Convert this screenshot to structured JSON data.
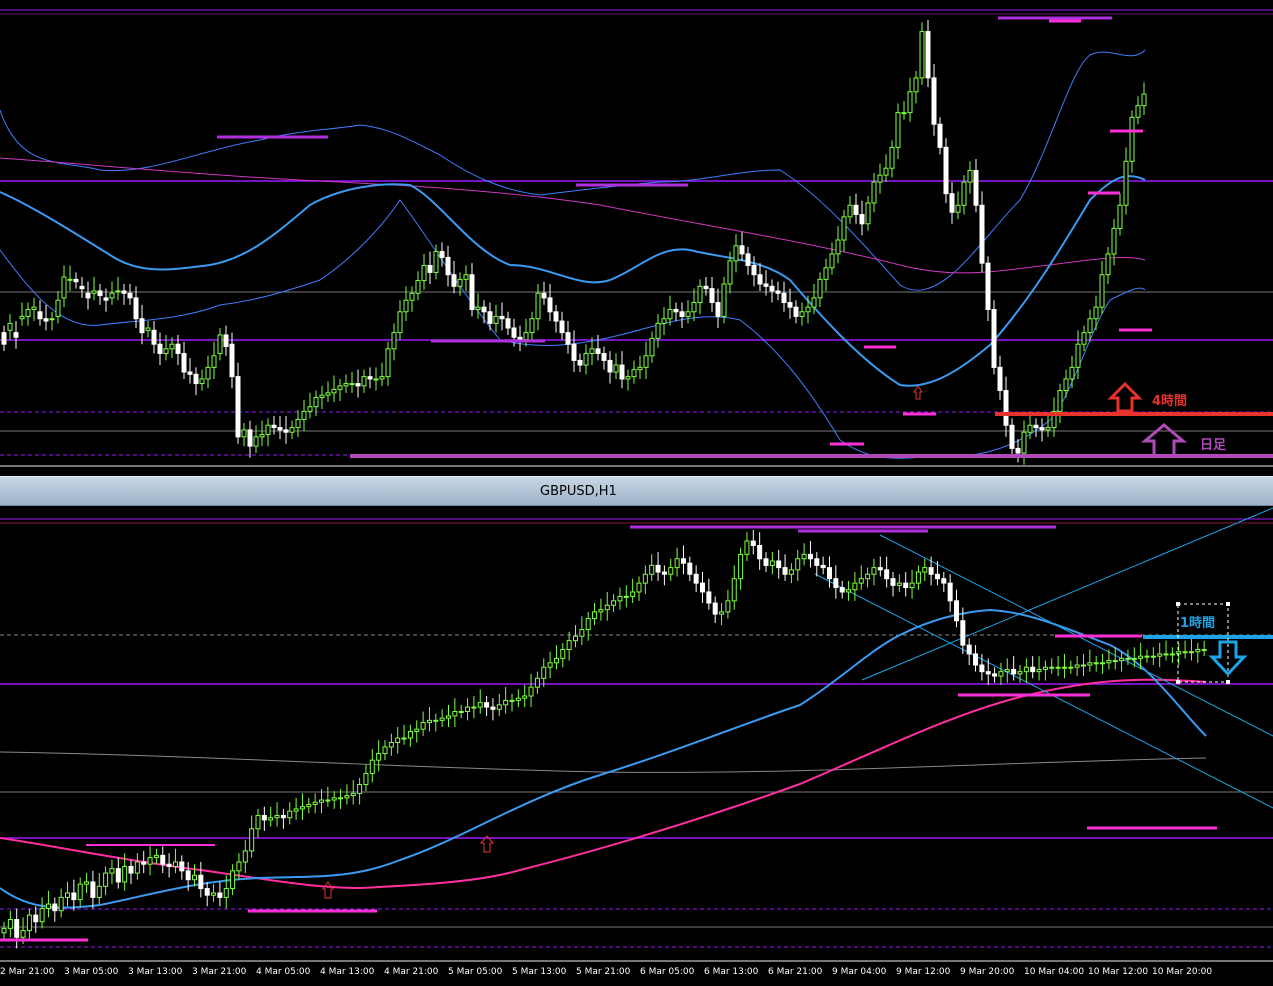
{
  "window": {
    "title": "GBPUSD,H1"
  },
  "labels": {
    "h4": "4時間",
    "daily": "日足",
    "h1": "1時間"
  },
  "time_axis": [
    "2 Mar 21:00",
    "3 Mar 05:00",
    "3 Mar 13:00",
    "3 Mar 21:00",
    "4 Mar 05:00",
    "4 Mar 13:00",
    "4 Mar 21:00",
    "5 Mar 05:00",
    "5 Mar 13:00",
    "5 Mar 21:00",
    "6 Mar 05:00",
    "6 Mar 13:00",
    "6 Mar 21:00",
    "9 Mar 04:00",
    "9 Mar 12:00",
    "9 Mar 20:00",
    "10 Mar 04:00",
    "10 Mar 12:00",
    "10 Mar 20:00"
  ],
  "colors": {
    "bull": "#7fff3f",
    "bear": "#ffffff",
    "h4_line": "#e8322c",
    "daily_line": "#b04ab8",
    "h1_line": "#1ea3e8",
    "level": "#9a1aff",
    "ma_blue": "#3a9bf0",
    "ma_pink": "#ff2fa0",
    "band": "#3f7fff"
  },
  "chart_data": [
    {
      "type": "candlestick",
      "title": "",
      "x": [
        0,
        1,
        2,
        3,
        4,
        5,
        6,
        7,
        8,
        9,
        10,
        11,
        12,
        13,
        14,
        15,
        16,
        17,
        18,
        19,
        20,
        21,
        22,
        23,
        24,
        25,
        26,
        27,
        28,
        29,
        30,
        31,
        32,
        33,
        34,
        35,
        36,
        37,
        38,
        39,
        40,
        41,
        42,
        43,
        44,
        45,
        46,
        47,
        48,
        49,
        50,
        51,
        52,
        53,
        54,
        55,
        56,
        57,
        58,
        59,
        60,
        61,
        62,
        63,
        64,
        65,
        66,
        67,
        68,
        69,
        70,
        71,
        72,
        73,
        74,
        75,
        76,
        77,
        78,
        79,
        80,
        81,
        82,
        83,
        84,
        85,
        86,
        87,
        88,
        89,
        90,
        91,
        92,
        93,
        94,
        95,
        96,
        97,
        98,
        99,
        100,
        101,
        102,
        103,
        104,
        105,
        106,
        107,
        108,
        109,
        110,
        111,
        112,
        113,
        114,
        115,
        116,
        117,
        118,
        119,
        120,
        121,
        122,
        123,
        124,
        125,
        126,
        127,
        128,
        129,
        130,
        131,
        132,
        133,
        134,
        135,
        136,
        137,
        138,
        139,
        140,
        141,
        142,
        143,
        144,
        145,
        146,
        147,
        148,
        149,
        150,
        151,
        152,
        153,
        154,
        155,
        156,
        157,
        158,
        159,
        160,
        161,
        162,
        163,
        164,
        165,
        166,
        167,
        168,
        169,
        170,
        171,
        172,
        173,
        174,
        175,
        176,
        177,
        178,
        179,
        180,
        181,
        182,
        183,
        184,
        185,
        186,
        187,
        188,
        189
      ],
      "close": [
        240,
        258,
        246,
        264,
        270,
        272,
        262,
        260,
        262,
        278,
        298,
        296,
        294,
        288,
        280,
        286,
        282,
        278,
        284,
        286,
        284,
        280,
        262,
        250,
        254,
        240,
        232,
        236,
        240,
        232,
        216,
        214,
        206,
        210,
        220,
        230,
        248,
        238,
        212,
        160,
        166,
        152,
        160,
        162,
        170,
        168,
        166,
        164,
        168,
        175,
        182,
        186,
        194,
        196,
        198,
        201,
        204,
        206,
        206,
        204,
        212,
        210,
        210,
        212,
        236,
        250,
        268,
        278,
        284,
        295,
        308,
        302,
        320,
        315,
        300,
        290,
        296,
        300,
        270,
        272,
        268,
        258,
        264,
        262,
        254,
        246,
        244,
        250,
        262,
        284,
        280,
        268,
        260,
        250,
        240,
        226,
        222,
        232,
        236,
        232,
        226,
        216,
        222,
        210,
        212,
        218,
        220,
        230,
        245,
        258,
        262,
        270,
        268,
        264,
        268,
        276,
        290,
        288,
        276,
        264,
        292,
        312,
        325,
        318,
        308,
        300,
        292,
        290,
        286,
        284,
        276,
        272,
        264,
        268,
        272,
        280,
        296,
        306,
        318,
        330,
        350,
        360,
        352,
        344,
        362,
        380,
        386,
        392,
        410,
        440,
        440,
        458,
        470,
        510,
        470,
        430,
        410,
        370,
        354,
        360,
        380,
        390,
        360,
        310,
        270,
        220,
        200,
        170,
        150,
        146,
        164,
        170,
        168,
        166,
        168,
        182,
        200,
        210,
        220,
        240,
        250,
        262,
        272,
        300,
        318,
        340,
        360,
        398,
        436,
        446,
        456
      ],
      "open": [
        250,
        252,
        250,
        262,
        264,
        270,
        268,
        262,
        262,
        264,
        280,
        296,
        296,
        290,
        284,
        284,
        286,
        280,
        280,
        286,
        286,
        284,
        280,
        262,
        252,
        252,
        240,
        232,
        236,
        240,
        232,
        216,
        214,
        206,
        210,
        220,
        232,
        248,
        240,
        212,
        160,
        166,
        152,
        160,
        162,
        170,
        168,
        166,
        164,
        168,
        175,
        182,
        186,
        194,
        196,
        198,
        201,
        204,
        206,
        206,
        204,
        212,
        210,
        210,
        212,
        236,
        250,
        268,
        278,
        284,
        295,
        308,
        302,
        320,
        315,
        300,
        290,
        296,
        300,
        270,
        272,
        268,
        258,
        264,
        262,
        254,
        246,
        244,
        250,
        262,
        284,
        280,
        268,
        260,
        250,
        240,
        226,
        222,
        232,
        236,
        232,
        226,
        216,
        222,
        210,
        212,
        218,
        220,
        230,
        245,
        258,
        262,
        270,
        268,
        264,
        268,
        276,
        290,
        288,
        276,
        264,
        292,
        312,
        325,
        318,
        308,
        300,
        292,
        290,
        286,
        284,
        276,
        272,
        264,
        268,
        272,
        280,
        296,
        306,
        318,
        330,
        350,
        360,
        352,
        344,
        362,
        380,
        386,
        392,
        410,
        440,
        440,
        458,
        470,
        510,
        470,
        430,
        410,
        370,
        354,
        360,
        380,
        390,
        360,
        310,
        270,
        220,
        200,
        170,
        150,
        146,
        164,
        170,
        168,
        166,
        168,
        182,
        200,
        210,
        220,
        240,
        250,
        262,
        272,
        300,
        318,
        340,
        360,
        398,
        436,
        446
      ]
    },
    {
      "type": "candlestick",
      "title": "GBPUSD,H1",
      "x": [
        0,
        1,
        2,
        3,
        4,
        5,
        6,
        7,
        8,
        9,
        10,
        11,
        12,
        13,
        14,
        15,
        16,
        17,
        18,
        19,
        20,
        21,
        22,
        23,
        24,
        25,
        26,
        27,
        28,
        29,
        30,
        31,
        32,
        33,
        34,
        35,
        36,
        37,
        38,
        39,
        40,
        41,
        42,
        43,
        44,
        45,
        46,
        47,
        48,
        49,
        50,
        51,
        52,
        53,
        54,
        55,
        56,
        57,
        58,
        59,
        60,
        61,
        62,
        63,
        64,
        65,
        66,
        67,
        68,
        69,
        70,
        71,
        72,
        73,
        74,
        75,
        76,
        77,
        78,
        79,
        80,
        81,
        82,
        83,
        84,
        85,
        86,
        87,
        88,
        89,
        90,
        91,
        92,
        93,
        94,
        95,
        96,
        97,
        98,
        99,
        100,
        101,
        102,
        103,
        104,
        105,
        106,
        107,
        108,
        109,
        110,
        111,
        112,
        113,
        114,
        115,
        116,
        117,
        118,
        119,
        120,
        121,
        122,
        123,
        124,
        125,
        126,
        127,
        128,
        129,
        130,
        131,
        132,
        133,
        134,
        135,
        136,
        137,
        138,
        139,
        140,
        141,
        142,
        143,
        144,
        145,
        146,
        147,
        148,
        149,
        150,
        151,
        152,
        153,
        154,
        155,
        156,
        157,
        158,
        159,
        160,
        161,
        162,
        163,
        164,
        165,
        166,
        167,
        168,
        169,
        170,
        171,
        172,
        173,
        174,
        175,
        176,
        177,
        178,
        179,
        180,
        181,
        182,
        183,
        184,
        185,
        186,
        187,
        188,
        189
      ],
      "close": [
        240,
        248,
        232,
        238,
        252,
        246,
        258,
        262,
        256,
        268,
        272,
        266,
        280,
        282,
        268,
        278,
        290,
        294,
        282,
        296,
        290,
        300,
        298,
        304,
        306,
        298,
        296,
        300,
        292,
        284,
        288,
        276,
        270,
        272,
        268,
        276,
        292,
        300,
        310,
        330,
        342,
        338,
        340,
        342,
        340,
        346,
        348,
        350,
        352,
        354,
        356,
        356,
        358,
        358,
        360,
        362,
        370,
        380,
        392,
        398,
        404,
        408,
        412,
        412,
        418,
        420,
        426,
        428,
        428,
        430,
        432,
        436,
        436,
        440,
        440,
        444,
        440,
        438,
        442,
        446,
        446,
        448,
        450,
        458,
        466,
        476,
        480,
        484,
        492,
        500,
        504,
        510,
        520,
        526,
        528,
        532,
        536,
        540,
        540,
        544,
        552,
        560,
        568,
        562,
        560,
        566,
        574,
        570,
        560,
        552,
        544,
        534,
        524,
        526,
        536,
        556,
        578,
        590,
        586,
        574,
        568,
        572,
        566,
        560,
        564,
        574,
        578,
        574,
        568,
        566,
        556,
        548,
        544,
        546,
        552,
        556,
        560,
        566,
        564,
        556,
        550,
        552,
        548,
        552,
        562,
        566,
        560,
        556,
        552,
        536,
        518,
        496,
        488,
        478,
        472,
        470,
        468,
        472,
        474,
        470,
        472,
        476,
        472,
        474,
        476,
        476,
        476,
        476,
        476,
        478,
        478,
        480,
        480,
        480,
        482,
        482,
        484,
        484,
        484,
        486,
        486,
        486,
        488,
        488,
        488,
        490,
        490,
        490,
        492,
        492
      ],
      "open": [
        236,
        240,
        248,
        232,
        238,
        252,
        246,
        258,
        262,
        256,
        268,
        272,
        266,
        280,
        282,
        268,
        278,
        290,
        294,
        282,
        296,
        290,
        300,
        298,
        304,
        306,
        298,
        296,
        300,
        292,
        284,
        288,
        276,
        270,
        272,
        268,
        276,
        292,
        300,
        310,
        330,
        342,
        338,
        340,
        342,
        340,
        346,
        348,
        350,
        352,
        354,
        356,
        356,
        358,
        358,
        360,
        362,
        370,
        380,
        392,
        398,
        404,
        408,
        412,
        412,
        418,
        420,
        426,
        428,
        428,
        430,
        432,
        436,
        436,
        440,
        440,
        444,
        440,
        438,
        442,
        446,
        446,
        448,
        450,
        458,
        466,
        476,
        480,
        484,
        492,
        500,
        504,
        510,
        520,
        526,
        528,
        532,
        536,
        540,
        540,
        544,
        552,
        560,
        568,
        562,
        560,
        566,
        574,
        570,
        560,
        552,
        544,
        534,
        524,
        526,
        536,
        556,
        578,
        590,
        586,
        574,
        568,
        572,
        566,
        560,
        564,
        574,
        578,
        574,
        568,
        566,
        556,
        548,
        544,
        546,
        552,
        556,
        560,
        566,
        564,
        556,
        550,
        552,
        548,
        552,
        562,
        566,
        560,
        556,
        552,
        536,
        518,
        496,
        488,
        478,
        472,
        470,
        468,
        472,
        474,
        470,
        472,
        476,
        472,
        474,
        476,
        476,
        476,
        476,
        476,
        478,
        478,
        480,
        480,
        480,
        482,
        482,
        484,
        484,
        484,
        486,
        486,
        486,
        488,
        488,
        488,
        490,
        490,
        490,
        492
      ]
    }
  ]
}
